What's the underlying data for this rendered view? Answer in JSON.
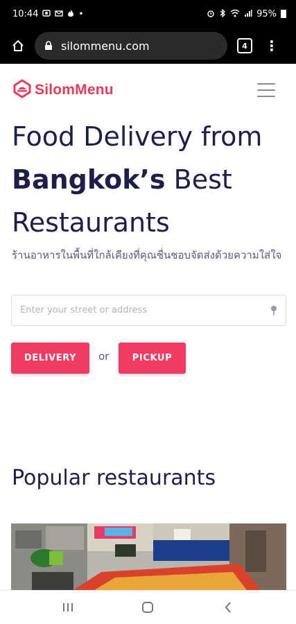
{
  "status_bar": {
    "time": "10:44",
    "battery": "95%",
    "left_icons": [
      "photo-icon",
      "mail-icon",
      "fire-icon",
      "dot-icon"
    ],
    "right_icons": [
      "alarm-icon",
      "bluetooth-icon",
      "wifi-icon",
      "signal-icon",
      "battery-icon"
    ]
  },
  "browser": {
    "url": "silommenu.com",
    "tab_count": "4"
  },
  "header": {
    "logo_text": "SilomMenu",
    "brand_color": "#e83a5c"
  },
  "hero": {
    "title_line1": "Food Delivery from",
    "title_bold": "Bangkok’s",
    "title_rest": " Best",
    "title_line3": "Restaurants",
    "subtitle": "ร้านอาหารในพื้นที่ใกล้เคียงที่คุณชื่นชอบจัดส่งด้วยความใส่ใจ"
  },
  "search": {
    "placeholder": "Enter your street or address",
    "value": ""
  },
  "actions": {
    "delivery_label": "DELIVERY",
    "or_label": "or",
    "pickup_label": "PICKUP",
    "accent_color": "#f03c63"
  },
  "popular": {
    "title": "Popular restaurants"
  }
}
